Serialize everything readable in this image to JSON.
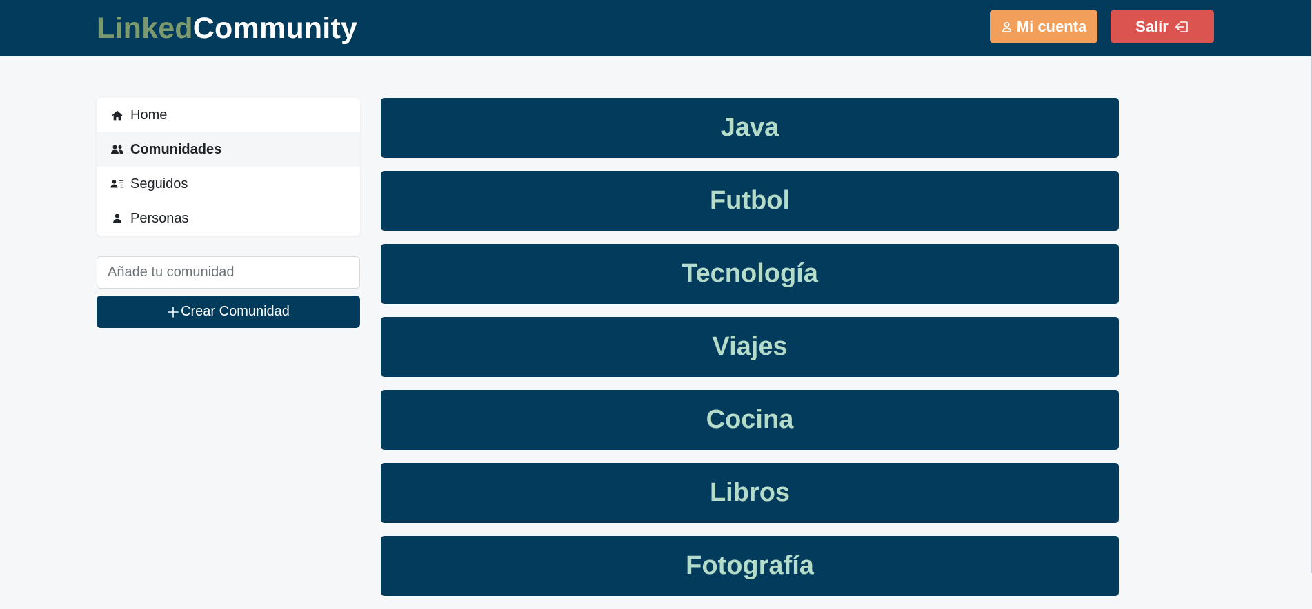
{
  "header": {
    "brand_part1": "Linked",
    "brand_part2": "Community",
    "account_label": "Mi cuenta",
    "account_icon": "person-outline-icon",
    "logout_label": "Salir",
    "logout_icon": "door-arrow-left-icon"
  },
  "sidebar": {
    "items": [
      {
        "label": "Home",
        "icon": "house-icon",
        "active": false
      },
      {
        "label": "Comunidades",
        "icon": "people-icon",
        "active": true
      },
      {
        "label": "Seguidos",
        "icon": "person-lines-icon",
        "active": false
      },
      {
        "label": "Personas",
        "icon": "person-icon",
        "active": false
      }
    ],
    "input_placeholder": "Añade tu comunidad",
    "create_button_label": "Crear Comunidad",
    "create_button_icon": "plus-icon"
  },
  "communities": [
    {
      "name": "Java"
    },
    {
      "name": "Futbol"
    },
    {
      "name": "Tecnología"
    },
    {
      "name": "Viajes"
    },
    {
      "name": "Cocina"
    },
    {
      "name": "Libros"
    },
    {
      "name": "Fotografía"
    }
  ],
  "colors": {
    "header_bg": "#033b5c",
    "brand_accent": "#7c9a6e",
    "account_button": "#f29f5c",
    "logout_button": "#dc5450",
    "card_bg": "#033b5c",
    "card_text": "#b5dbc9",
    "page_bg": "#f6f7f9"
  }
}
